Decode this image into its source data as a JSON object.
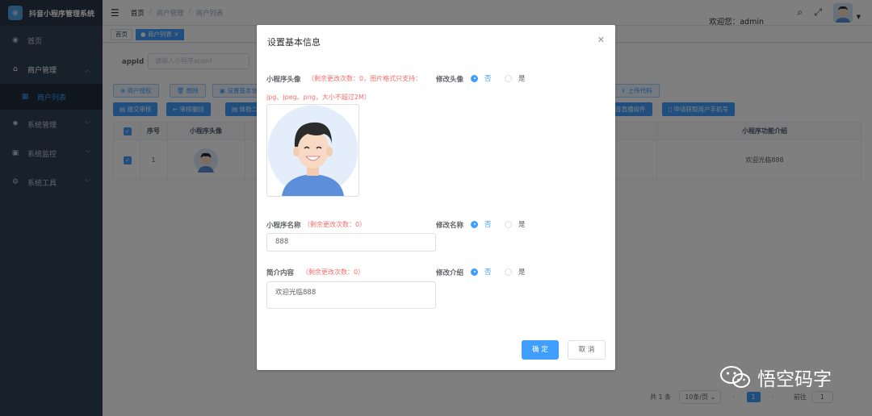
{
  "app": {
    "title": "抖音小程序管理系统"
  },
  "sidebar": {
    "items": [
      {
        "label": "首页",
        "icon": "dashboard-icon"
      },
      {
        "label": "商户管理",
        "icon": "merchant-icon",
        "open": true
      },
      {
        "label": "系统管理",
        "icon": "settings-icon"
      },
      {
        "label": "系统监控",
        "icon": "monitor-icon"
      },
      {
        "label": "系统工具",
        "icon": "tools-icon"
      }
    ],
    "subitems": [
      {
        "label": "商户列表",
        "icon": "list-icon"
      }
    ]
  },
  "header": {
    "breadcrumb": [
      "首页",
      "商户管理",
      "商户列表"
    ],
    "welcome": "欢迎您：admin"
  },
  "tags": [
    {
      "label": "首页"
    },
    {
      "label": "商户列表",
      "active": true
    }
  ],
  "search": {
    "label": "appId",
    "placeholder": "请输入小程序appId"
  },
  "toolbar": {
    "row1": [
      "商户授权",
      "删除",
      "设置基本信",
      "上传代码"
    ],
    "row2": [
      "提交审核",
      "审核撤回",
      "体验二",
      "音直播组件",
      "申请获取用户手机号"
    ]
  },
  "table": {
    "headers": {
      "index": "序号",
      "avatar": "小程序头像",
      "intro": "小程序功能介绍"
    },
    "rows": [
      {
        "index": "1",
        "intro": "欢迎光临888"
      }
    ]
  },
  "pagination": {
    "total": "共 1 条",
    "page_size": "10条/页",
    "current": "1",
    "goto_label": "前往",
    "goto_value": "1"
  },
  "dialog": {
    "title": "设置基本信息",
    "avatar_label": "小程序头像",
    "avatar_hint": "（剩余更改次数：0，图片格式只支持：",
    "avatar_hint2": "jpg、jpeg、png，大小不超过2M）",
    "modify_avatar": "修改头像",
    "name_label": "小程序名称",
    "name_hint": "（剩余更改次数：0）",
    "name_value": "888",
    "modify_name": "修改名称",
    "intro_label": "简介内容",
    "intro_hint": "（剩余更改次数：0）",
    "intro_value": "欢迎光临888",
    "modify_intro": "修改介绍",
    "no": "否",
    "yes": "是",
    "ok": "确 定",
    "cancel": "取 消"
  },
  "watermark": {
    "text": "悟空码字"
  },
  "colors": {
    "primary": "#409eff",
    "sidebar": "#304156",
    "danger": "#f56c6c"
  }
}
